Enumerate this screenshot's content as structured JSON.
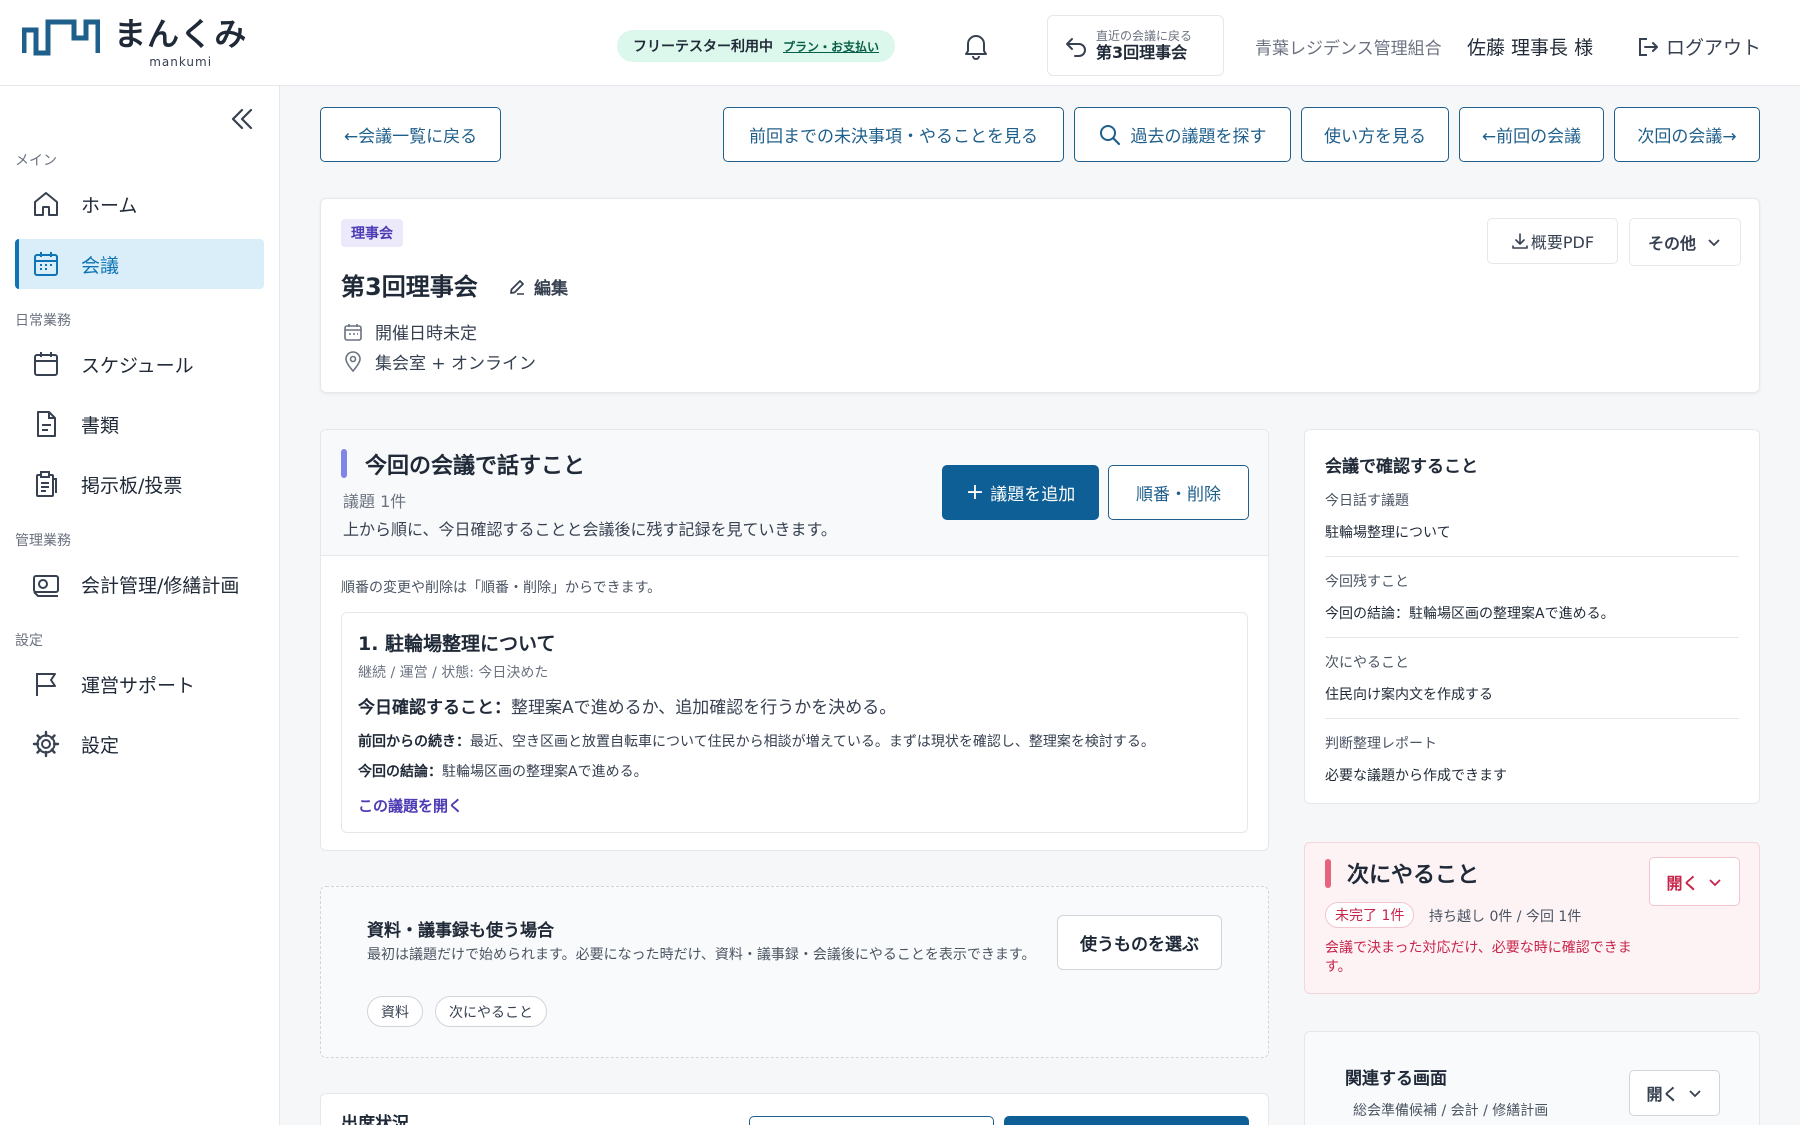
{
  "app": {
    "logo_text": "まんくみ",
    "logo_subtext": "mankumi"
  },
  "header": {
    "plan_status": "フリーテスター利用中",
    "plan_link": "プラン・お支払い",
    "recent_label": "直近の会議に戻る",
    "recent_meeting": "第3回理事会",
    "org_name": "青葉レジデンス管理組合",
    "user_name": "佐藤 理事長 様",
    "logout": "ログアウト"
  },
  "sidebar": {
    "sections": {
      "main": "メイン",
      "daily": "日常業務",
      "management": "管理業務",
      "settings": "設定"
    },
    "items": [
      {
        "label": "ホーム",
        "icon": "home-icon"
      },
      {
        "label": "会議",
        "icon": "calendar-icon",
        "active": true
      },
      {
        "label": "スケジュール",
        "icon": "calendar-outline-icon"
      },
      {
        "label": "書類",
        "icon": "document-icon"
      },
      {
        "label": "掲示板/投票",
        "icon": "clipboard-icon"
      },
      {
        "label": "会計管理/修繕計画",
        "icon": "money-icon"
      },
      {
        "label": "運営サポート",
        "icon": "flag-icon"
      },
      {
        "label": "設定",
        "icon": "gear-icon"
      }
    ]
  },
  "toolbar": {
    "back_list": "←会議一覧に戻る",
    "unresolved": "前回までの未決事項・やることを見る",
    "search_past": "過去の議題を探す",
    "howto": "使い方を見る",
    "prev_meeting": "←前回の会議",
    "next_meeting": "次回の会議→"
  },
  "meeting": {
    "badge": "理事会",
    "title": "第3回理事会",
    "edit": "編集",
    "datetime": "開催日時未定",
    "location": "集会室 + オンライン",
    "pdf_button": "概要PDF",
    "other_button": "その他"
  },
  "agenda": {
    "title": "今回の会議で話すこと",
    "count": "議題 1件",
    "description": "上から順に、今日確認することと会議後に残す記録を見ていきます。",
    "add_button": "議題を追加",
    "order_button": "順番・削除",
    "note": "順番の変更や削除は「順番・削除」からできます。",
    "item": {
      "title": "1. 駐輪場整理について",
      "meta": "継続 / 運営 / 状態: 今日決めた",
      "confirm_label": "今日確認すること：",
      "confirm_text": "整理案Aで進めるか、追加確認を行うかを決める。",
      "continued_label": "前回からの続き：",
      "continued_text": "最近、空き区画と放置自転車について住民から相談が増えている。まずは現状を確認し、整理案を検討する。",
      "conclusion_label": "今回の結論：",
      "conclusion_text": "駐輪場区画の整理案Aで進める。",
      "open_link": "この議題を開く"
    }
  },
  "materials": {
    "title": "資料・議事録も使う場合",
    "description": "最初は議題だけで始められます。必要になった時だけ、資料・議事録・会議後にやることを表示できます。",
    "chips": [
      "資料",
      "次にやること"
    ],
    "choose_button": "使うものを選ぶ"
  },
  "attendance": {
    "title": "出席状況"
  },
  "confirm_panel": {
    "title": "会議で確認すること",
    "rows": [
      {
        "label": "今日話す議題",
        "value": "駐輪場整理について"
      },
      {
        "label": "今回残すこと",
        "value": "今回の結論：駐輪場区画の整理案Aで進める。"
      },
      {
        "label": "次にやること",
        "value": "住民向け案内文を作成する"
      },
      {
        "label": "判断整理レポート",
        "value": "必要な議題から作成できます"
      }
    ]
  },
  "next_panel": {
    "title": "次にやること",
    "badge": "未完了 1件",
    "stats": "持ち越し 0件 / 今回 1件",
    "description": "会議で決まった対応だけ、必要な時に確認できます。",
    "open_button": "開く"
  },
  "related_panel": {
    "title": "関連する画面",
    "subtitle": "総会準備候補 / 会計 / 修繕計画",
    "open_button": "開く"
  },
  "colors": {
    "primary": "#0e5f95",
    "accent_purple": "#7f86e8",
    "accent_red": "#e5647e",
    "active_bg": "#d9eef8"
  }
}
